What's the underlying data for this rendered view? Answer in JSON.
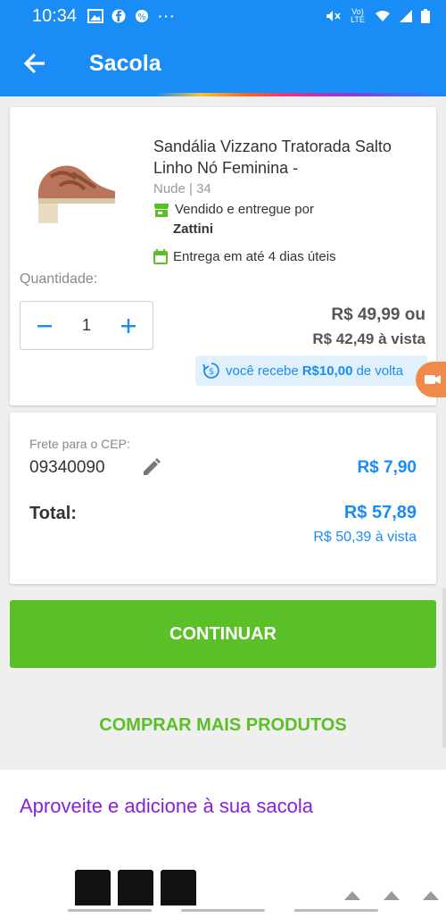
{
  "status_bar": {
    "time": "10:34",
    "network": "Vo) LTE"
  },
  "header": {
    "title": "Sacola"
  },
  "product": {
    "name": "Sandália Vizzano Tratorada Salto Linho Nó Feminina -",
    "variant": "Nude | 34",
    "seller_prefix": "Vendido e entregue por",
    "seller_name": "Zattini",
    "delivery": "Entrega em até 4 dias úteis",
    "quantity_label": "Quantidade:",
    "quantity": "1",
    "price": "R$ 49,99 ou",
    "price_cash": "R$ 42,49 à vista",
    "cashback_prefix": "você recebe",
    "cashback_amount": "R$10,00",
    "cashback_suffix": "de volta"
  },
  "freight": {
    "cep_label": "Frete para o CEP:",
    "cep_value": "09340090",
    "price": "R$ 7,90",
    "total_label": "Total:",
    "total_price": "R$ 57,89",
    "total_cash": "R$ 50,39 à vista"
  },
  "actions": {
    "continue_label": "CONTINUAR",
    "more_label": "COMPRAR MAIS PRODUTOS"
  },
  "recommendations": {
    "title": "Aproveite e adicione à sua sacola"
  },
  "colors": {
    "primary": "#1a8cf5",
    "green": "#5bbf27",
    "purple": "#8b1fd6"
  }
}
